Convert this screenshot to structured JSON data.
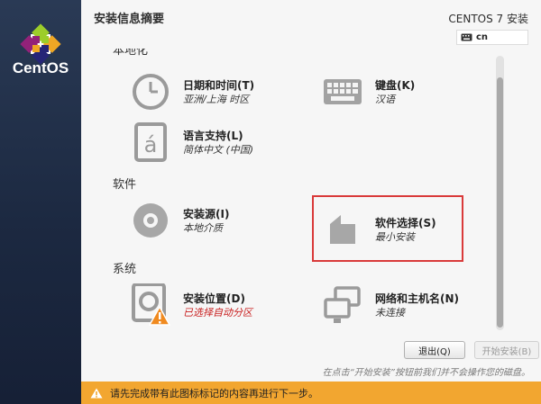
{
  "brand": {
    "name": "CentOS"
  },
  "header": {
    "title": "安装信息摘要",
    "product": "CENTOS 7 安装",
    "keyboard_indicator": "cn"
  },
  "sections": {
    "localization": {
      "label": "本地化",
      "date_time": {
        "title": "日期和时间(T)",
        "status": "亚洲/上海 时区"
      },
      "keyboard": {
        "title": "键盘(K)",
        "status": "汉语"
      },
      "language": {
        "title": "语言支持(L)",
        "status": "简体中文 (中国)"
      }
    },
    "software": {
      "label": "软件",
      "source": {
        "title": "安装源(I)",
        "status": "本地介质"
      },
      "selection": {
        "title": "软件选择(S)",
        "status": "最小安装"
      }
    },
    "system": {
      "label": "系统",
      "destination": {
        "title": "安装位置(D)",
        "status": "已选择自动分区"
      },
      "network": {
        "title": "网络和主机名(N)",
        "status": "未连接"
      }
    }
  },
  "buttons": {
    "quit": "退出(Q)",
    "begin": "开始安装(B)"
  },
  "hint": "在点击“开始安装”按钮前我们并不会操作您的磁盘。",
  "warning_bar": {
    "text": "请先完成带有此图标标记的内容再进行下一步。"
  },
  "colors": {
    "sidebar": "#1c2941",
    "warning_bar": "#f2a630",
    "highlight": "#d93a3a",
    "error_text": "#c81e1e"
  }
}
